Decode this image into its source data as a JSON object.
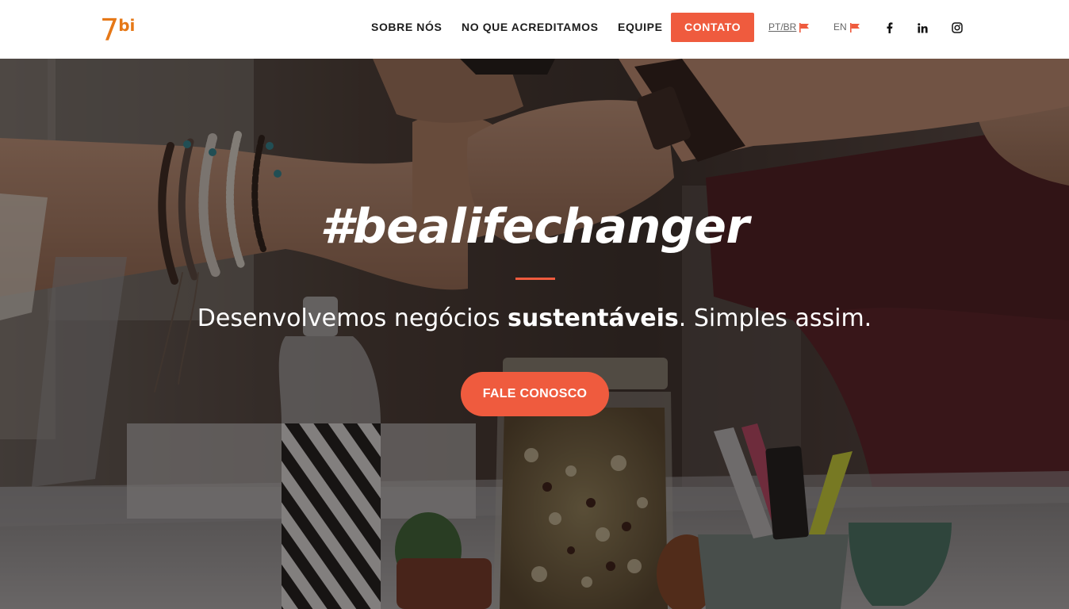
{
  "brand": {
    "logo_main": "7",
    "logo_sup": "bi",
    "color": "#e67817"
  },
  "nav": {
    "items": [
      {
        "label": "SOBRE NÓS"
      },
      {
        "label": "NO QUE ACREDITAMOS"
      },
      {
        "label": "EQUIPE"
      }
    ],
    "cta_label": "CONTATO",
    "languages": [
      {
        "label": "PT/BR",
        "active": true,
        "icon": "flag-icon"
      },
      {
        "label": "EN",
        "active": false,
        "icon": "flag-icon"
      }
    ],
    "social": [
      {
        "icon": "facebook-icon"
      },
      {
        "icon": "linkedin-icon"
      },
      {
        "icon": "instagram-icon"
      }
    ]
  },
  "hero": {
    "title": "#bealifechanger",
    "subtitle_pre": "Desenvolvemos negócios ",
    "subtitle_bold": "sustentáveis",
    "subtitle_post": ". Simples assim.",
    "button_label": "FALE CONOSCO"
  },
  "colors": {
    "accent": "#ef5b3e",
    "header_bg": "#ffffff",
    "nav_text": "#1d1d1d"
  }
}
